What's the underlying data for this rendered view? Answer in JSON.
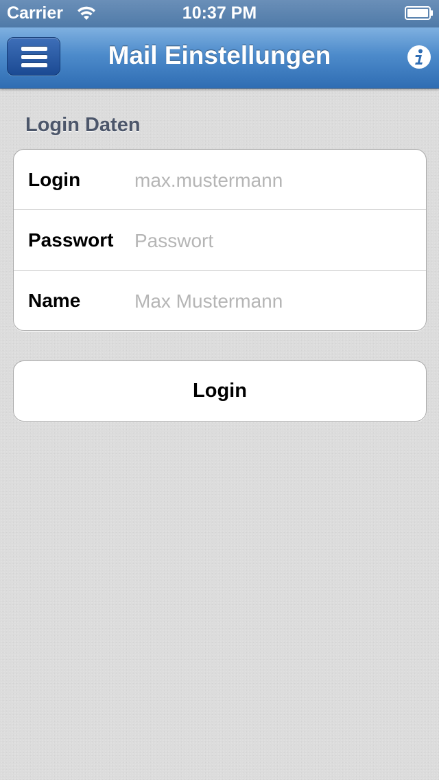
{
  "status_bar": {
    "carrier": "Carrier",
    "time": "10:37 PM",
    "wifi_icon": "wifi-icon",
    "battery_icon": "battery-icon"
  },
  "nav_bar": {
    "title": "Mail Einstellungen",
    "menu_icon": "hamburger-menu-icon",
    "info_icon": "info-icon",
    "color": "#3a78bd"
  },
  "section": {
    "header": "Login Daten"
  },
  "form": {
    "rows": [
      {
        "label": "Login",
        "placeholder": "max.mustermann",
        "value": ""
      },
      {
        "label": "Passwort",
        "placeholder": "Passwort",
        "value": ""
      },
      {
        "label": "Name",
        "placeholder": "Max Mustermann",
        "value": ""
      }
    ]
  },
  "login_button": {
    "label": "Login"
  }
}
